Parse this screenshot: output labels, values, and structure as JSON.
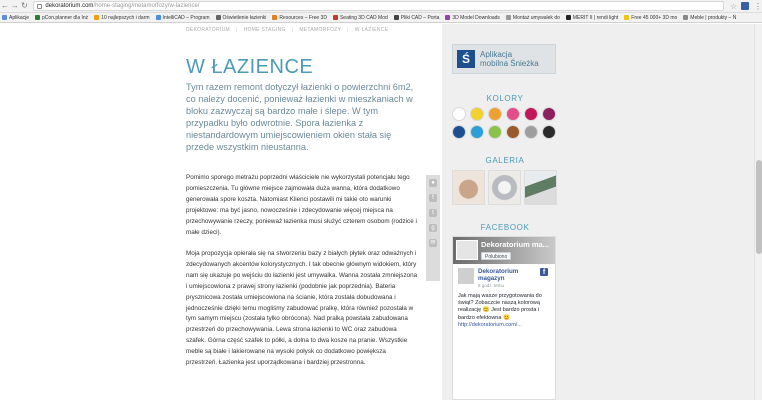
{
  "browser": {
    "url_host": "dekoratorium.com",
    "url_path": "/home-staging/metamorfozy/w-lazience/",
    "bookmarks": [
      {
        "label": "Aplikacje",
        "color": "#5b8dd9"
      },
      {
        "label": "pCon.planner dla Inż",
        "color": "#2e7d32"
      },
      {
        "label": "10 najlepszych i darm",
        "color": "#f39c12"
      },
      {
        "label": "IntelliCAD – Program",
        "color": "#4a90e2"
      },
      {
        "label": "Oświetlenie łazienki",
        "color": "#666666"
      },
      {
        "label": "Resources – Free 3D",
        "color": "#e67e22"
      },
      {
        "label": "Seating 3D CAD Mod",
        "color": "#c0392b"
      },
      {
        "label": "Pliki CAD – Porta",
        "color": "#444444"
      },
      {
        "label": "3D Model Downloads",
        "color": "#8e44ad"
      },
      {
        "label": "Montaż umywalek do",
        "color": "#999999"
      },
      {
        "label": "MERIT II | rendi light",
        "color": "#222222"
      },
      {
        "label": "Free 45 000+ 3D mo",
        "color": "#f1c40f"
      },
      {
        "label": "Meble | produkty – Ń",
        "color": "#888888"
      }
    ]
  },
  "breadcrumb": [
    "Dekoratorium",
    "Home staging",
    "Metamorfozy",
    "W łazience"
  ],
  "article": {
    "title": "W ŁAZIENCE",
    "lead": "Tym razem remont dotyczył łazienki o powierzchni 6m2, co należy docenić, ponieważ łazienki w mieszkaniach w bloku zazwyczaj są bardzo małe i ślepe. W tym przypadku było odwrotnie. Spora łazienka z niestandardowym umiejscowieniem okien stała się przede wszystkim nieustanna.",
    "p1": "Pomimo sporego metrażu poprzedni właściciele nie wykorzystali potencjału tego pomieszczenia. Tu główne miejsce zajmowała duża wanna, która dodatkowo generowała spore koszta. Natomiast Klienci postawili mi takie oto warunki projektowe: ma być jasno, nowocześnie i zdecydowanie więcej miejsca na przechowywanie rzeczy, ponieważ łazienka musi służyć czterem osobom (rodzice i małe dzieci).",
    "p2": "Moja propozycja opierała się na stworzeniu bazy z białych płytek oraz odważnych i zdecydowanych akcentów kolorystycznych. I tak obecnie głównym widokiem, który nam się ukazuje po wejściu do łazienki jest umywalka. Wanna została zmniejszona i umiejscowiona z prawej strony łazienki (podobnie jak poprzednia). Bateria prysznicowa została umiejscowiona na ścianie, która została dobudowana i jednocześnie dzięki temu mogliśmy zabudować pralkę, która również pozostała w tym samym miejscu (została tylko obrócona). Nad pralką powstała zabudowana przestrzeń do przechowywania. Lewa strona łazienki to WC oraz zabudowa szafek. Górna część szafek to półki, a dolna to dwa kosze na pranie. Wszystkie meble są białe i lakierowane na wysoki połysk co dodatkowo powiększa przestrzeń. Łazienka jest uporządkowana i bardziej przestronna."
  },
  "sidebar": {
    "app_badge_line1": "Aplikacja",
    "app_badge_line2": "mobilna Śnieżka",
    "kolory_title": "KOLORY",
    "colors": [
      "#ffffff",
      "#f2d22e",
      "#f0a030",
      "#e84b8a",
      "#c2185b",
      "#8e1f5e",
      "#1e4f8f",
      "#2c9ed8",
      "#8bc34a",
      "#9a5a2e",
      "#9e9e9e",
      "#2b2b2b"
    ],
    "galeria_title": "GALERIA",
    "facebook_title": "FACEBOOK",
    "fb": {
      "cover_title": "Dekoratorium ma...",
      "like_label": "Polubiono",
      "page_name": "Dekoratorium magazyn",
      "time": "6 godz. temu",
      "post": "Jak mają wasze przygotowania do świąt? Zobaczcie naszą kolorową realizację 😊 Jest bardzo prosta i bardzo efektowna 😊",
      "link": "http://dekoratorium.com/..."
    }
  }
}
